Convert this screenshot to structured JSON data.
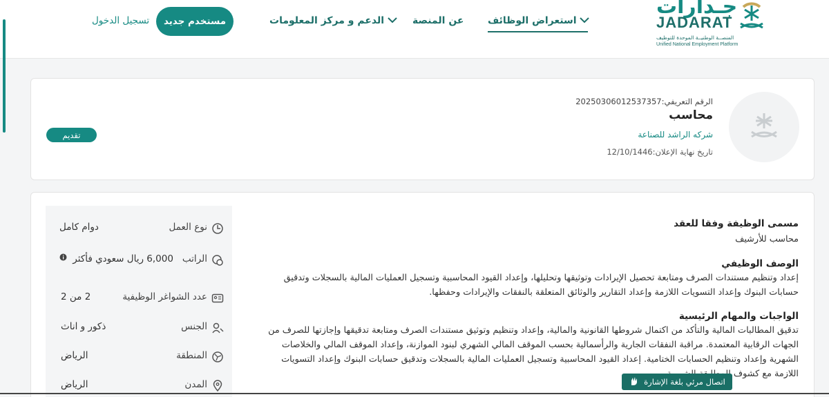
{
  "header": {
    "logo_ar": "جـدارات",
    "logo_en": "JADARAT",
    "logo_sub_ar": "المنصــة الوطنيــة الموحدة للتوظيف",
    "logo_sub_en": "Unified National Employment Platform",
    "nav": {
      "jobs": "استعراض الوظائف",
      "about": "عن المنصة",
      "support": "الدعم و مركز المعلومات"
    },
    "new_user": "مستخدم جديد",
    "login": "تسجيل الدخول"
  },
  "job": {
    "id_line": "الرقم التعريفي:20250306012537357",
    "title": "محاسب",
    "company": "شركه الراشد للصناعة",
    "deadline": "تاريخ نهاية الإعلان:12/10/1446",
    "apply": "تقديم"
  },
  "attributes": [
    {
      "label": "نوع العمل",
      "value": "دوام كامل",
      "icon": "clock-icon"
    },
    {
      "label": "الراتب",
      "value": "6,000 ريال سعودي فأكثر",
      "icon": "money-icon"
    },
    {
      "label": "عدد الشواغر الوظيفية",
      "value": "2 من 2",
      "icon": "id-card-icon"
    },
    {
      "label": "الجنس",
      "value": "ذكور و اناث",
      "icon": "gender-icon"
    },
    {
      "label": "المنطقة",
      "value": "الرياض",
      "icon": "map-icon"
    },
    {
      "label": "المدن",
      "value": "الرياض",
      "icon": "location-pin-icon"
    }
  ],
  "content": {
    "contract_title": "مسمى الوظيفة وفقا للعقد",
    "contract_value": "محاسب للأرشيف",
    "desc_title": "الوصف الوظيفي",
    "desc_text": "إعداد وتنظيم مستندات الصرف ومتابعة تحصيل الإيرادات وتوثيقها وتحليلها، وإعداد القيود المحاسبية وتسجيل العمليات المالية بالسجلات وتدقيق حسابات البنوك وإعداد التسويات اللازمة وإعداد التقارير والوثائق المتعلقة بالنفقات والإيرادات وحفظها.",
    "duties_title": "الواجبات والمهام الرئيسية",
    "duties_text": "تدقيق المطالبات المالية والتأكد من اكتمال شروطها القانونية والمالية، وإعداد وتنظيم وتوثيق مستندات الصرف ومتابعة تدقيقها وإجازتها للصرف من الجهات الرقابية المعتمدة. مراقبة النفقات الجارية والرأسمالية بحسب الموقف المالي الشهري لبنود الموازنة، وإعداد الموقف المالي والخلاصات الشهرية وإعداد وتنظيم الحسابات الختامية. إعداد القيود المحاسبية وتسجيل العمليات المالية بالسجلات وتدقيق حسابات البنوك وإعداد التسويات اللازمة مع كشوف المطابقة الشهرية"
  },
  "sign_language": "اتصال مرئي بلغة الإشارة",
  "colors": {
    "accent": "#168a83",
    "nav_text": "#1d6f69"
  }
}
